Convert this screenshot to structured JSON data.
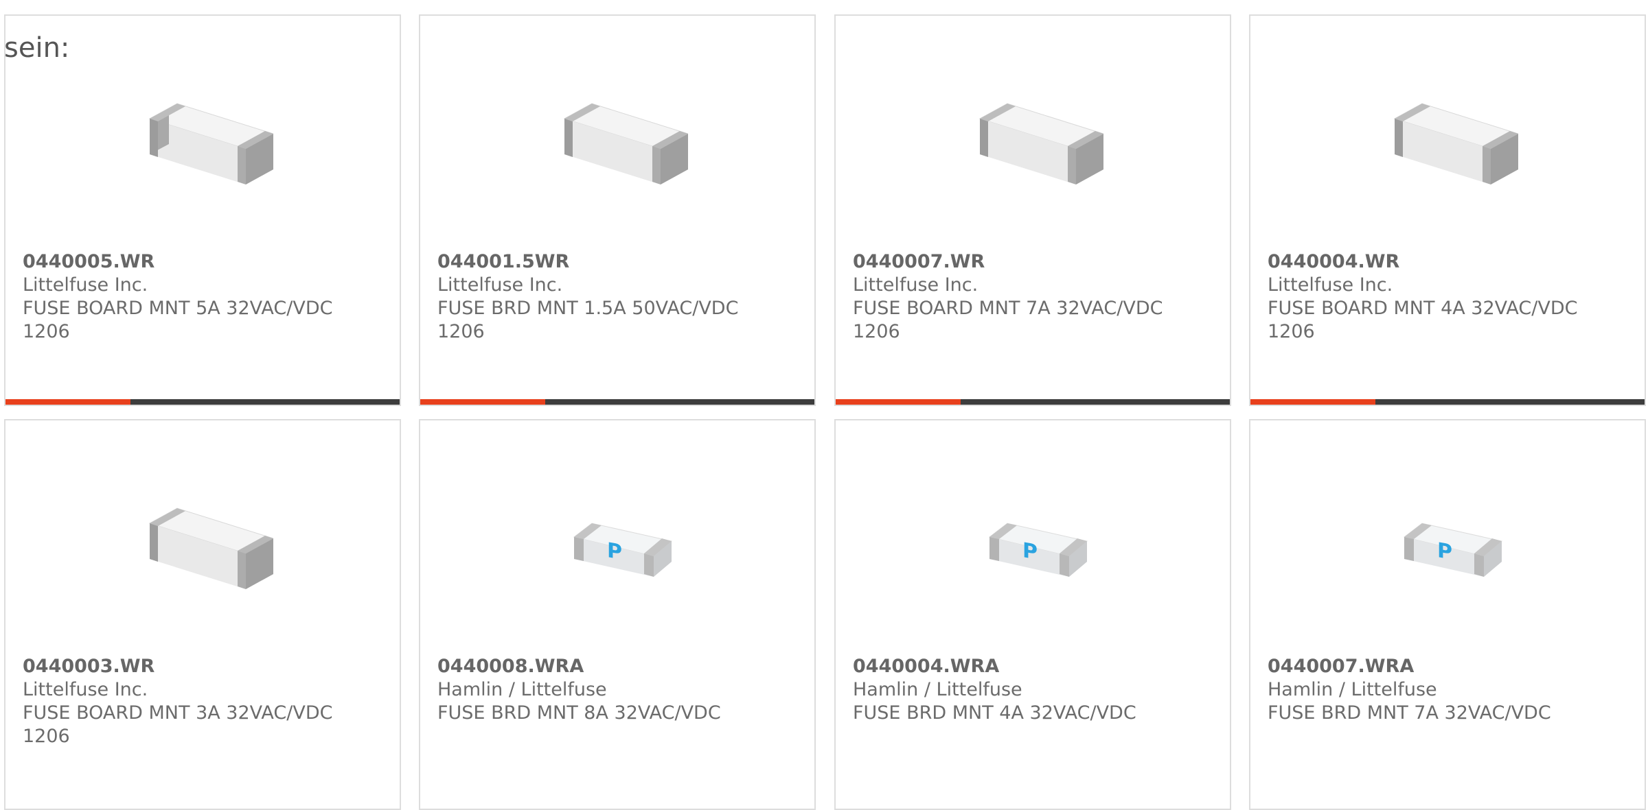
{
  "intro_text": "sein:",
  "colors": {
    "accent": "#e8401c",
    "bar": "#3d3d3d"
  },
  "products": [
    {
      "part": "0440005.WR",
      "maker": "Littelfuse Inc.",
      "desc": "FUSE BOARD MNT 5A 32VAC/VDC",
      "pkg": "1206",
      "image": "chip-fuse-plain-icon"
    },
    {
      "part": "044001.5WR",
      "maker": "Littelfuse Inc.",
      "desc": "FUSE BRD MNT 1.5A 50VAC/VDC",
      "pkg": "1206",
      "image": "chip-fuse-plain-icon"
    },
    {
      "part": "0440007.WR",
      "maker": "Littelfuse Inc.",
      "desc": "FUSE BOARD MNT 7A 32VAC/VDC",
      "pkg": "1206",
      "image": "chip-fuse-plain-icon"
    },
    {
      "part": "0440004.WR",
      "maker": "Littelfuse Inc.",
      "desc": "FUSE BOARD MNT 4A 32VAC/VDC",
      "pkg": "1206",
      "image": "chip-fuse-plain-icon"
    },
    {
      "part": "0440003.WR",
      "maker": "Littelfuse Inc.",
      "desc": "FUSE BOARD MNT 3A 32VAC/VDC",
      "pkg": "1206",
      "image": "chip-fuse-plain-icon"
    },
    {
      "part": "0440008.WRA",
      "maker": "Hamlin / Littelfuse",
      "desc": "FUSE BRD MNT 8A 32VAC/VDC",
      "pkg": "",
      "image": "chip-fuse-marked-icon"
    },
    {
      "part": "0440004.WRA",
      "maker": "Hamlin / Littelfuse",
      "desc": "FUSE BRD MNT 4A 32VAC/VDC",
      "pkg": "",
      "image": "chip-fuse-marked-icon"
    },
    {
      "part": "0440007.WRA",
      "maker": "Hamlin / Littelfuse",
      "desc": "FUSE BRD MNT 7A 32VAC/VDC",
      "pkg": "",
      "image": "chip-fuse-marked-icon"
    }
  ]
}
